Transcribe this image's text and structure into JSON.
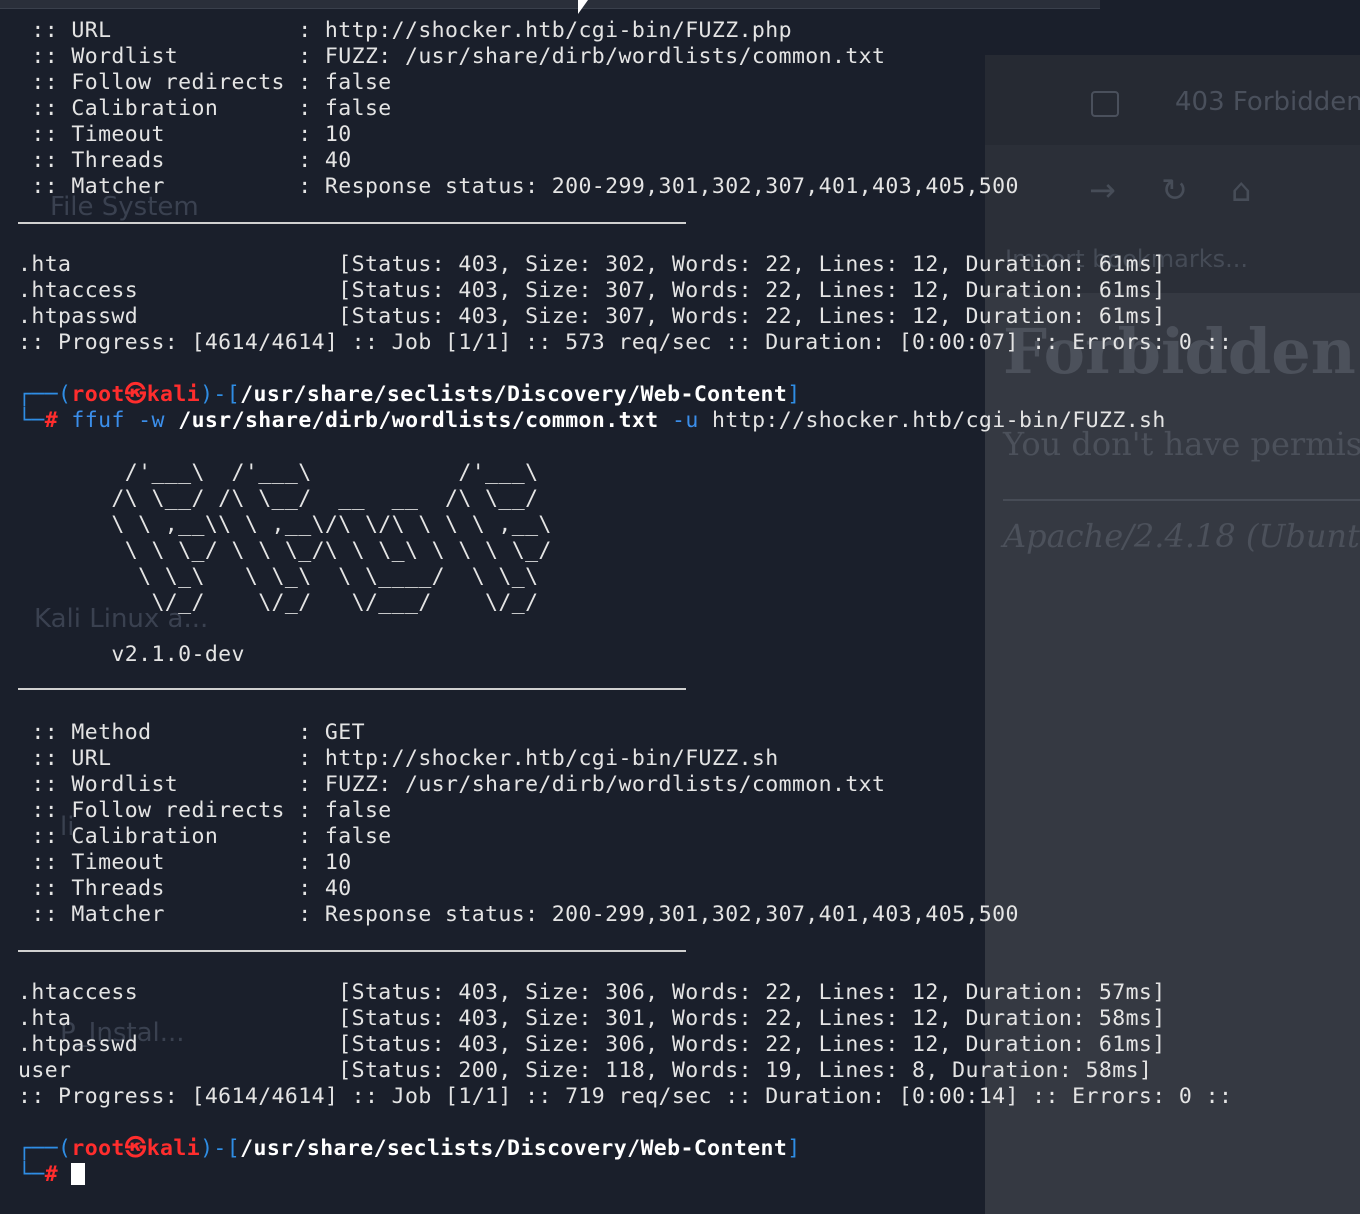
{
  "background": {
    "browser_tab_title": "403 Forbidden",
    "bookmarks_label": "Import bookmarks...",
    "page_heading": "Forbidden",
    "page_text": "You don't have permis",
    "page_address": "Apache/2.4.18 (Ubunt",
    "desktop_labels": [
      "File System",
      "Kali Linux a...",
      "li",
      "P_Instal..."
    ]
  },
  "terminal": {
    "config1": [
      {
        "key": " :: URL              ",
        "value": ": http://shocker.htb/cgi-bin/FUZZ.php"
      },
      {
        "key": " :: Wordlist         ",
        "value": ": FUZZ: /usr/share/dirb/wordlists/common.txt"
      },
      {
        "key": " :: Follow redirects ",
        "value": ": false"
      },
      {
        "key": " :: Calibration      ",
        "value": ": false"
      },
      {
        "key": " :: Timeout          ",
        "value": ": 10"
      },
      {
        "key": " :: Threads          ",
        "value": ": 40"
      },
      {
        "key": " :: Matcher          ",
        "value": ": Response status: 200-299,301,302,307,401,403,405,500"
      }
    ],
    "results1": [
      {
        "name": ".hta                    ",
        "info": "[Status: 403, Size: 302, Words: 22, Lines: 12, Duration: 61ms]"
      },
      {
        "name": ".htaccess               ",
        "info": "[Status: 403, Size: 307, Words: 22, Lines: 12, Duration: 61ms]"
      },
      {
        "name": ".htpasswd               ",
        "info": "[Status: 403, Size: 307, Words: 22, Lines: 12, Duration: 61ms]"
      }
    ],
    "progress1": ":: Progress: [4614/4614] :: Job [1/1] :: 573 req/sec :: Duration: [0:00:07] :: Errors: 0 ::",
    "prompt": {
      "user": "root",
      "at": "㉿",
      "host": "kali",
      "path": "/usr/share/seclists/Discovery/Web-Content"
    },
    "command": {
      "bin": "ffuf",
      "opt_w": "-w",
      "wordlist": "/usr/share/dirb/wordlists/common.txt",
      "opt_u": "-u",
      "url": "http://shocker.htb/cgi-bin/FUZZ.sh"
    },
    "banner": [
      "        /'___\\  /'___\\           /'___\\",
      "       /\\ \\__/ /\\ \\__/  __  __  /\\ \\__/",
      "       \\ \\ ,__\\\\ \\ ,__\\/\\ \\/\\ \\ \\ \\ ,__\\",
      "        \\ \\ \\_/ \\ \\ \\_/\\ \\ \\_\\ \\ \\ \\ \\_/",
      "         \\ \\_\\   \\ \\_\\  \\ \\____/  \\ \\_\\",
      "          \\/_/    \\/_/   \\/___/    \\/_/"
    ],
    "version": "       v2.1.0-dev",
    "config2": [
      {
        "key": " :: Method           ",
        "value": ": GET"
      },
      {
        "key": " :: URL              ",
        "value": ": http://shocker.htb/cgi-bin/FUZZ.sh"
      },
      {
        "key": " :: Wordlist         ",
        "value": ": FUZZ: /usr/share/dirb/wordlists/common.txt"
      },
      {
        "key": " :: Follow redirects ",
        "value": ": false"
      },
      {
        "key": " :: Calibration      ",
        "value": ": false"
      },
      {
        "key": " :: Timeout          ",
        "value": ": 10"
      },
      {
        "key": " :: Threads          ",
        "value": ": 40"
      },
      {
        "key": " :: Matcher          ",
        "value": ": Response status: 200-299,301,302,307,401,403,405,500"
      }
    ],
    "results2": [
      {
        "name": ".htaccess               ",
        "info": "[Status: 403, Size: 306, Words: 22, Lines: 12, Duration: 57ms]"
      },
      {
        "name": ".hta                    ",
        "info": "[Status: 403, Size: 301, Words: 22, Lines: 12, Duration: 58ms]"
      },
      {
        "name": ".htpasswd               ",
        "info": "[Status: 403, Size: 306, Words: 22, Lines: 12, Duration: 61ms]"
      },
      {
        "name": "user                    ",
        "info": "[Status: 200, Size: 118, Words: 19, Lines: 8, Duration: 58ms]"
      }
    ],
    "progress2": ":: Progress: [4614/4614] :: Job [1/1] :: 719 req/sec :: Duration: [0:00:14] :: Errors: 0 ::",
    "prompt_symbol": "#",
    "box_top": "┌──(",
    "box_bottom": "└─"
  }
}
